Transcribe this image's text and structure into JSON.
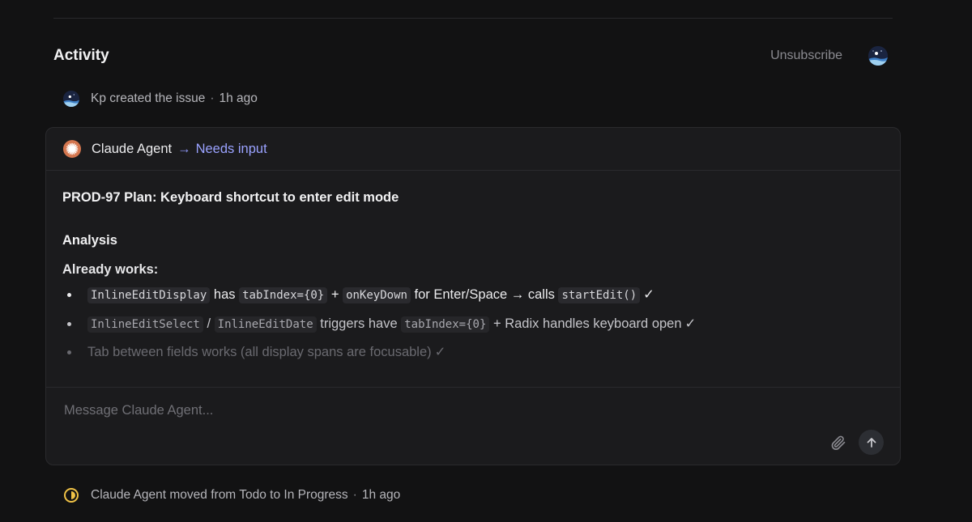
{
  "activity": {
    "title": "Activity",
    "unsubscribe_label": "Unsubscribe"
  },
  "events": [
    {
      "actor": "Kp",
      "action": "created the issue",
      "time": "1h ago"
    },
    {
      "actor": "Claude Agent",
      "action": "moved from Todo to In Progress",
      "time": "1h ago"
    }
  ],
  "comment": {
    "author": "Claude Agent",
    "arrow": "→",
    "status": "Needs input",
    "plan_title": "PROD-97 Plan: Keyboard shortcut to enter edit mode",
    "section_heading": "Analysis",
    "sub_heading": "Already works:",
    "items": [
      {
        "code1": "InlineEditDisplay",
        "text1": "has",
        "code2": "tabIndex={0}",
        "text2": "+",
        "code3": "onKeyDown",
        "text3": "for Enter/Space → calls",
        "code4": "startEdit()",
        "check": "✓"
      },
      {
        "code1": "InlineEditSelect",
        "text1": "/",
        "code2": "InlineEditDate",
        "text2": "triggers have",
        "code3": "tabIndex={0}",
        "text3": "+ Radix handles keyboard open",
        "check": "✓"
      },
      {
        "text1": "Tab between fields works (all display spans are focusable)",
        "check": "✓"
      }
    ]
  },
  "composer": {
    "placeholder": "Message Claude Agent...",
    "value": ""
  },
  "icons": {
    "avatar": "avatar-icon",
    "agent": "claude-agent-icon",
    "attach": "paperclip-icon",
    "send": "arrow-up-icon",
    "status": "half-circle-status-icon"
  },
  "colors": {
    "background": "#121213",
    "card": "#1b1b1d",
    "accent_link": "#9aa2ff",
    "agent_icon": "#d4764f",
    "status_in_progress": "#f0c246"
  }
}
